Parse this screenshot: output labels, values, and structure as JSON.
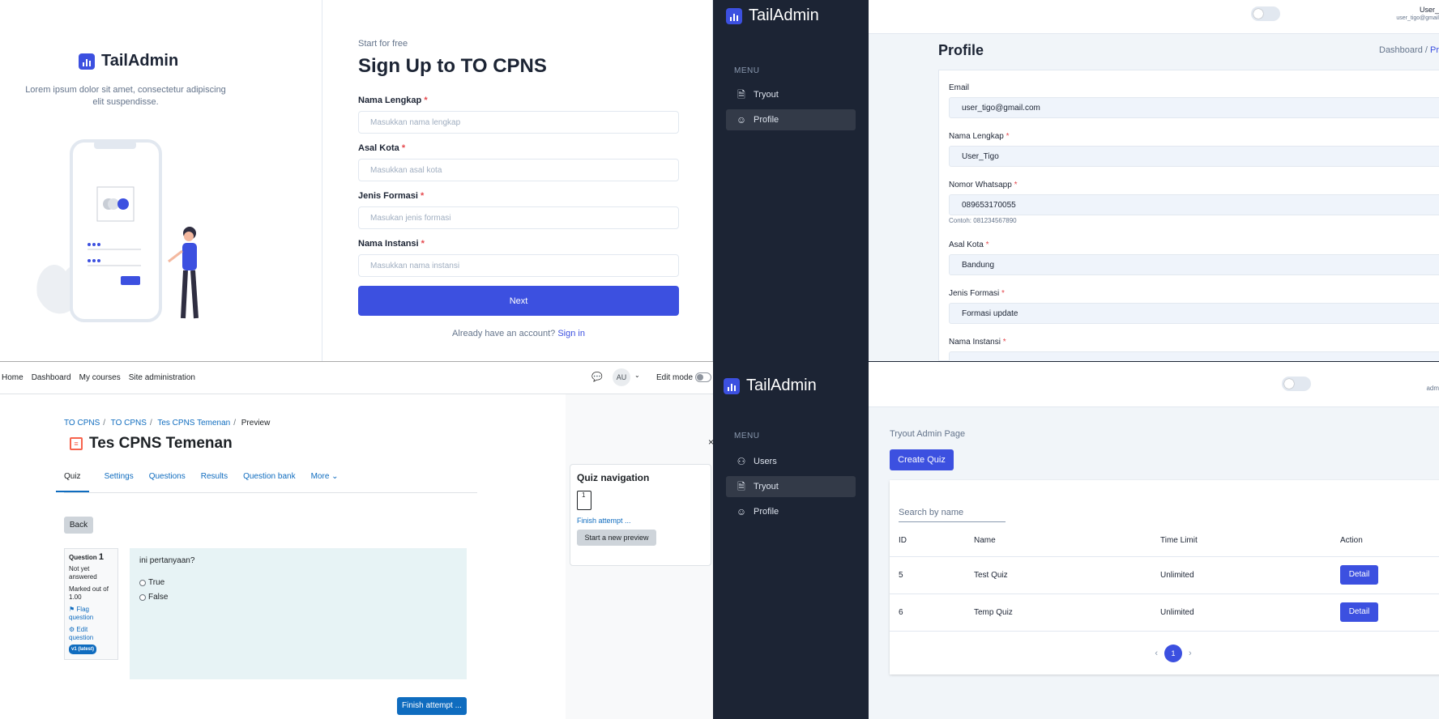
{
  "brand": {
    "name": "TailAdmin",
    "accent": "#3c50e0",
    "sidebar_bg": "#1c2434"
  },
  "signup": {
    "brand_desc": "Lorem ipsum dolor sit amet, consectetur adipiscing elit suspendisse.",
    "eyebrow": "Start for free",
    "title": "Sign Up to TO CPNS",
    "fields": [
      {
        "label": "Nama Lengkap",
        "placeholder": "Masukkan nama lengkap"
      },
      {
        "label": "Asal Kota",
        "placeholder": "Masukkan asal kota"
      },
      {
        "label": "Jenis Formasi",
        "placeholder": "Masukan jenis formasi"
      },
      {
        "label": "Nama Instansi",
        "placeholder": "Masukkan nama instansi"
      }
    ],
    "next_label": "Next",
    "already_text": "Already have an account?",
    "signin_label": "Sign in"
  },
  "profile": {
    "menu_heading": "MENU",
    "menu": [
      {
        "label": "Tryout",
        "icon": "document-icon"
      },
      {
        "label": "Profile",
        "icon": "user-plus-icon",
        "active": true
      }
    ],
    "user_name": "User_",
    "user_email": "user_tigo@gmail",
    "title": "Profile",
    "crumb_root": "Dashboard /",
    "crumb_current": "Pr",
    "fields": [
      {
        "label": "Email",
        "value": "user_tigo@gmail.com"
      },
      {
        "label": "Nama Lengkap",
        "value": "User_Tigo"
      },
      {
        "label": "Nomor Whatsapp",
        "value": "089653170055",
        "hint": "Contoh: 081234567890"
      },
      {
        "label": "Asal Kota",
        "value": "Bandung"
      },
      {
        "label": "Jenis Formasi",
        "value": "Formasi update"
      },
      {
        "label": "Nama Instansi",
        "value": ""
      }
    ]
  },
  "quiz": {
    "nav_links": [
      "Home",
      "Dashboard",
      "My courses",
      "Site administration"
    ],
    "avatar": "AU",
    "edit_mode": "Edit mode",
    "breadcrumbs": [
      "TO CPNS",
      "TO CPNS",
      "Tes CPNS Temenan"
    ],
    "breadcrumb_current": "Preview",
    "title": "Tes CPNS Temenan",
    "tabs": [
      "Quiz",
      "Settings",
      "Questions",
      "Results",
      "Question bank",
      "More ⌄"
    ],
    "back": "Back",
    "question_label": "Question",
    "question_number": "1",
    "status": "Not yet answered",
    "marked": "Marked out of 1.00",
    "flag": "Flag question",
    "edit_question": "Edit question",
    "version": "v1 (latest)",
    "question_text": "ini pertanyaan?",
    "options": [
      "True",
      "False"
    ],
    "finish_attempt": "Finish attempt ...",
    "help": "?",
    "close": "×",
    "nav_title": "Quiz navigation",
    "nav_box": "1",
    "nav_finish": "Finish attempt ...",
    "start_new": "Start a new preview"
  },
  "admin": {
    "menu_heading": "MENU",
    "menu": [
      {
        "label": "Users",
        "icon": "users-icon"
      },
      {
        "label": "Tryout",
        "icon": "document-icon",
        "active": true
      },
      {
        "label": "Profile",
        "icon": "user-plus-icon"
      }
    ],
    "user_short": "adm",
    "page_title": "Tryout Admin Page",
    "create_label": "Create Quiz",
    "search_placeholder": "Search by name",
    "columns": [
      "ID",
      "Name",
      "Time Limit",
      "Action"
    ],
    "rows": [
      {
        "id": "5",
        "name": "Test Quiz",
        "time_limit": "Unlimited",
        "action": "Detail"
      },
      {
        "id": "6",
        "name": "Temp Quiz",
        "time_limit": "Unlimited",
        "action": "Detail"
      }
    ],
    "pager_prev": "‹",
    "current_page": "1",
    "pager_next": "›"
  }
}
